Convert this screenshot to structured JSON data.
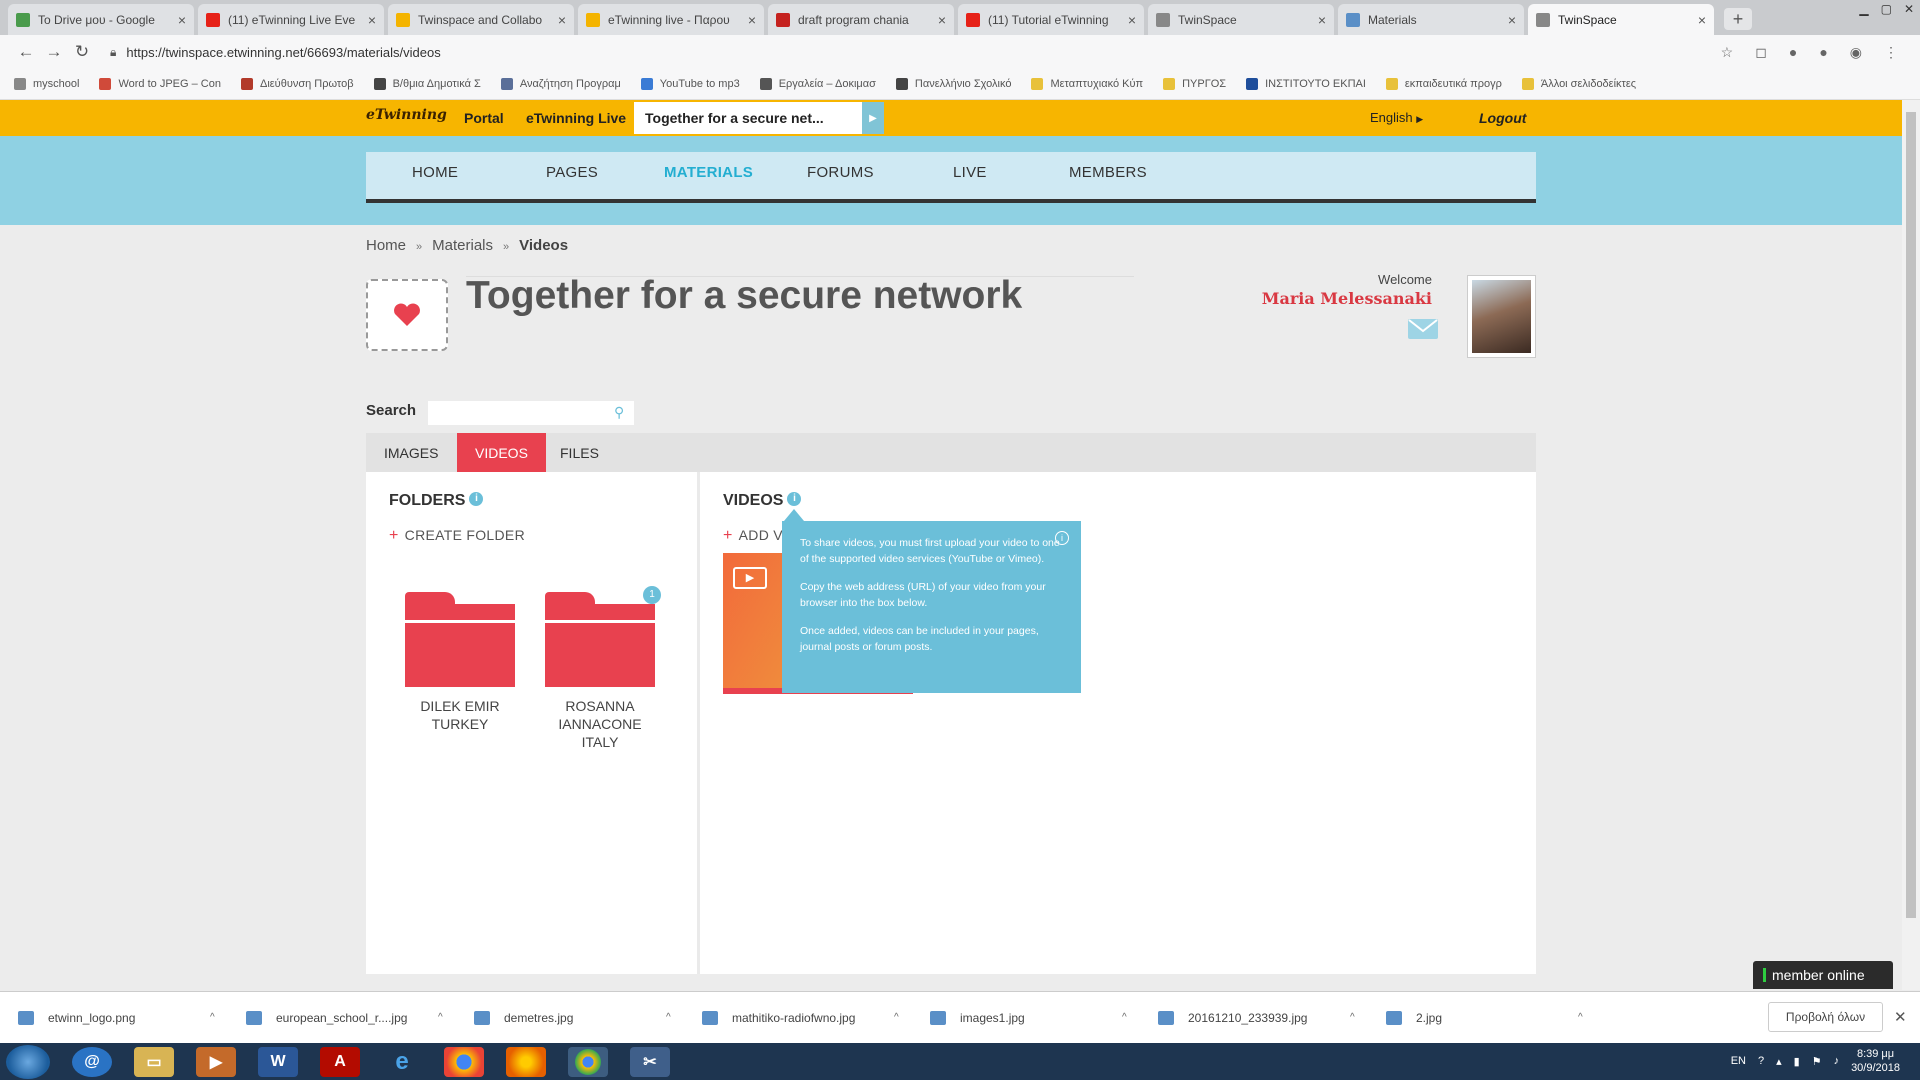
{
  "browser": {
    "tabs": [
      {
        "title": "Το Drive μου - Google",
        "color": "#4a9b4c"
      },
      {
        "title": "(11) eTwinning Live Eve",
        "color": "#e62117"
      },
      {
        "title": "Twinspace and Collabo",
        "color": "#f4b400"
      },
      {
        "title": "eTwinning live - Παρου",
        "color": "#f4b400"
      },
      {
        "title": "draft program chania",
        "color": "#c5221f"
      },
      {
        "title": "(11) Tutorial eTwinning",
        "color": "#e62117"
      },
      {
        "title": "TwinSpace",
        "color": "#888888"
      },
      {
        "title": "Materials",
        "color": "#5a8fc7"
      },
      {
        "title": "TwinSpace",
        "color": "#888888"
      }
    ],
    "active_tab_index": 8,
    "close_glyph": "×",
    "new_tab_glyph": "+",
    "url": "https://twinspace.etwinning.net/66693/materials/videos",
    "bookmarks": [
      {
        "label": "myschool",
        "color": "#888888"
      },
      {
        "label": "Word to JPEG – Con",
        "color": "#d04a3a"
      },
      {
        "label": "Διεύθυνση Πρωτοβ",
        "color": "#b23a2a"
      },
      {
        "label": "Β/θμια Δημοτικά Σ",
        "color": "#444444"
      },
      {
        "label": "Αναζήτηση Προγραμ",
        "color": "#5a6f99"
      },
      {
        "label": "YouTube to mp3",
        "color": "#3a7bd5"
      },
      {
        "label": "Εργαλεία – Δοκιμασ",
        "color": "#555555"
      },
      {
        "label": "Πανελλήνιο Σχολικό",
        "color": "#444444"
      },
      {
        "label": "Μεταπτυχιακό Κύπ",
        "color": "#e8c13a"
      },
      {
        "label": "ΠΥΡΓΟΣ",
        "color": "#e8c13a"
      },
      {
        "label": "ΙΝΣΤΙΤΟΥΤΟ ΕΚΠΑΙ",
        "color": "#1f4e9b"
      },
      {
        "label": "εκπαιδευτικά προγρ",
        "color": "#e8c13a"
      },
      {
        "label": "Άλλοι σελιδοδείκτες",
        "color": "#e8c13a"
      }
    ]
  },
  "site": {
    "logo_text": "eTwinning",
    "top_links": [
      "Portal",
      "eTwinning Live"
    ],
    "project_short": "Together for a secure net...",
    "language": "English",
    "logout": "Logout",
    "menu": [
      "HOME",
      "PAGES",
      "MATERIALS",
      "FORUMS",
      "LIVE",
      "MEMBERS"
    ],
    "active_menu": "MATERIALS",
    "breadcrumb": [
      "Home",
      "Materials",
      "Videos"
    ],
    "breadcrumb_sep": "»",
    "project_title": "Together for a secure network",
    "welcome": "Welcome",
    "user_name": "Maria Melessanaki",
    "search_label": "Search",
    "search_placeholder": "",
    "tabs": [
      "IMAGES",
      "VIDEOS",
      "FILES"
    ],
    "active_tab": "VIDEOS",
    "folders_heading": "FOLDERS",
    "create_folder": "CREATE FOLDER",
    "folders": [
      {
        "name": "DILEK EMIR TURKEY",
        "badge": ""
      },
      {
        "name": "ROSANNA IANNACONE ITALY",
        "badge": "1"
      }
    ],
    "videos_heading": "VIDEOS",
    "add_video": "ADD V",
    "info_glyph": "i",
    "tooltip": [
      "To share videos, you must first upload your video to one of the supported video services (YouTube or Vimeo).",
      "Copy the web address (URL) of your video from your browser into the box below.",
      "Once added, videos can be included in your pages, journal posts or forum posts."
    ],
    "member_online": "member online",
    "accent": "#e8414f",
    "topbar_color": "#f7b500"
  },
  "downloads": {
    "items": [
      "etwinn_logo.png",
      "european_school_r....jpg",
      "demetres.jpg",
      "mathitiko-radiofwno.jpg",
      "images1.jpg",
      "20161210_233939.jpg",
      "2.jpg"
    ],
    "show_all": "Προβολή όλων"
  },
  "taskbar": {
    "lang": "EN",
    "time": "8:39 μμ",
    "date": "30/9/2018"
  }
}
